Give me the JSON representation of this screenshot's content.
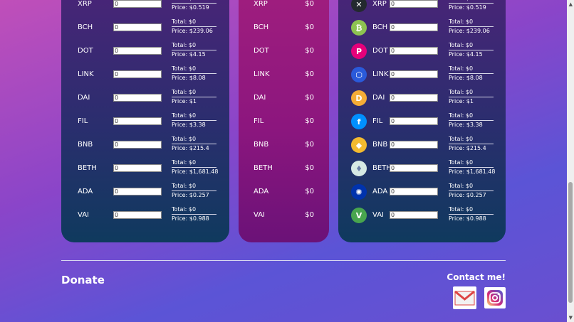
{
  "coins": [
    {
      "symbol": "XRP",
      "qty": "0",
      "total": "Total: $0",
      "price": "Price: $0.519",
      "value": "$0"
    },
    {
      "symbol": "BCH",
      "qty": "0",
      "total": "Total: $0",
      "price": "Price: $239.06",
      "value": "$0"
    },
    {
      "symbol": "DOT",
      "qty": "0",
      "total": "Total: $0",
      "price": "Price: $4.15",
      "value": "$0"
    },
    {
      "symbol": "LINK",
      "qty": "0",
      "total": "Total: $0",
      "price": "Price: $8.08",
      "value": "$0"
    },
    {
      "symbol": "DAI",
      "qty": "0",
      "total": "Total: $0",
      "price": "Price: $1",
      "value": "$0"
    },
    {
      "symbol": "FIL",
      "qty": "0",
      "total": "Total: $0",
      "price": "Price: $3.38",
      "value": "$0"
    },
    {
      "symbol": "BNB",
      "qty": "0",
      "total": "Total: $0",
      "price": "Price: $215.4",
      "value": "$0"
    },
    {
      "symbol": "BETH",
      "qty": "0",
      "total": "Total: $0",
      "price": "Price: $1,681.48",
      "value": "$0"
    },
    {
      "symbol": "ADA",
      "qty": "0",
      "total": "Total: $0",
      "price": "Price: $0.257",
      "value": "$0"
    },
    {
      "symbol": "VAI",
      "qty": "0",
      "total": "Total: $0",
      "price": "Price: $0.988",
      "value": "$0"
    }
  ],
  "coin_icons": [
    {
      "name": "xrp-icon",
      "color": "#23292f",
      "glyph": "✕"
    },
    {
      "name": "bch-icon",
      "color": "#8dc351",
      "glyph": "₿"
    },
    {
      "name": "dot-icon",
      "color": "#e6007a",
      "glyph": "P"
    },
    {
      "name": "link-icon",
      "color": "#2a5ada",
      "glyph": "⬡"
    },
    {
      "name": "dai-icon",
      "color": "#f5ac37",
      "glyph": "D"
    },
    {
      "name": "fil-icon",
      "color": "#0090ff",
      "glyph": "f"
    },
    {
      "name": "bnb-icon",
      "color": "#f3ba2f",
      "glyph": "◆"
    },
    {
      "name": "beth-icon",
      "color": "#d6e9e4",
      "glyph": "♦"
    },
    {
      "name": "ada-icon",
      "color": "#0033ad",
      "glyph": "✺"
    },
    {
      "name": "vai-icon",
      "color": "#48a54e",
      "glyph": "V"
    }
  ],
  "footer": {
    "donate": "Donate",
    "contact": "Contact me!"
  },
  "colors": {
    "card_dark": "#2a2e6e",
    "card_magenta": "#8c167e"
  }
}
